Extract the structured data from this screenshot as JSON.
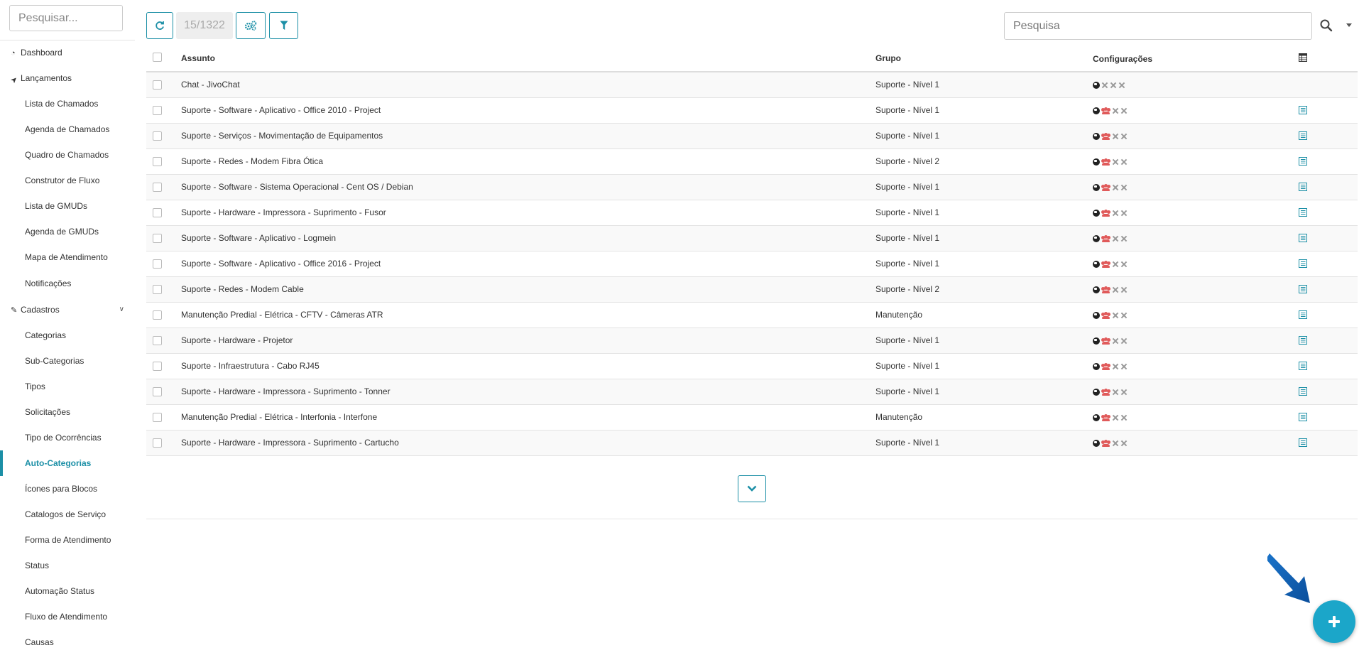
{
  "sidebar": {
    "search_placeholder": "Pesquisar...",
    "items": [
      {
        "label": "Dashboard",
        "icon": "dashboard-icon",
        "level": "top"
      },
      {
        "label": "Lançamentos",
        "icon": "location-arrow-icon",
        "level": "top"
      },
      {
        "label": "Lista de Chamados",
        "level": "sub"
      },
      {
        "label": "Agenda de Chamados",
        "level": "sub"
      },
      {
        "label": "Quadro de Chamados",
        "level": "sub"
      },
      {
        "label": "Construtor de Fluxo",
        "level": "sub"
      },
      {
        "label": "Lista de GMUDs",
        "level": "sub"
      },
      {
        "label": "Agenda de GMUDs",
        "level": "sub"
      },
      {
        "label": "Mapa de Atendimento",
        "level": "sub"
      },
      {
        "label": "Notificações",
        "level": "sub"
      },
      {
        "label": "Cadastros",
        "icon": "edit-icon",
        "level": "top",
        "expanded": true
      },
      {
        "label": "Categorias",
        "level": "sub"
      },
      {
        "label": "Sub-Categorias",
        "level": "sub"
      },
      {
        "label": "Tipos",
        "level": "sub"
      },
      {
        "label": "Solicitações",
        "level": "sub"
      },
      {
        "label": "Tipo de Ocorrências",
        "level": "sub"
      },
      {
        "label": "Auto-Categorias",
        "level": "sub",
        "active": true
      },
      {
        "label": "Ícones para Blocos",
        "level": "sub"
      },
      {
        "label": "Catalogos de Serviço",
        "level": "sub"
      },
      {
        "label": "Forma de Atendimento",
        "level": "sub"
      },
      {
        "label": "Status",
        "level": "sub"
      },
      {
        "label": "Automação Status",
        "level": "sub"
      },
      {
        "label": "Fluxo de Atendimento",
        "level": "sub"
      },
      {
        "label": "Causas",
        "level": "sub"
      }
    ]
  },
  "toolbar": {
    "record_count": "15/1322",
    "search_placeholder": "Pesquisa",
    "buttons": [
      "refresh-icon",
      "settings-icon",
      "filter-icon"
    ]
  },
  "table": {
    "headers": {
      "assunto": "Assunto",
      "grupo": "Grupo",
      "config": "Configurações"
    },
    "rows": [
      {
        "assunto": "Chat - JivoChat",
        "grupo": "Suporte - Nível 1",
        "users": false,
        "action": false
      },
      {
        "assunto": "Suporte - Software - Aplicativo - Office 2010 - Project",
        "grupo": "Suporte - Nível 1",
        "users": true,
        "action": true
      },
      {
        "assunto": "Suporte - Serviços - Movimentação de Equipamentos",
        "grupo": "Suporte - Nível 1",
        "users": true,
        "action": true
      },
      {
        "assunto": "Suporte - Redes - Modem Fibra Ótica",
        "grupo": "Suporte - Nível 2",
        "users": true,
        "action": true
      },
      {
        "assunto": "Suporte - Software - Sistema Operacional - Cent OS / Debian",
        "grupo": "Suporte - Nível 1",
        "users": true,
        "action": true
      },
      {
        "assunto": "Suporte - Hardware - Impressora - Suprimento - Fusor",
        "grupo": "Suporte - Nível 1",
        "users": true,
        "action": true
      },
      {
        "assunto": "Suporte - Software - Aplicativo - Logmein",
        "grupo": "Suporte - Nível 1",
        "users": true,
        "action": true
      },
      {
        "assunto": "Suporte - Software - Aplicativo - Office 2016 - Project",
        "grupo": "Suporte - Nível 1",
        "users": true,
        "action": true
      },
      {
        "assunto": "Suporte - Redes - Modem Cable",
        "grupo": "Suporte - Nível 2",
        "users": true,
        "action": true
      },
      {
        "assunto": "Manutenção Predial - Elétrica - CFTV - Câmeras ATR",
        "grupo": "Manutenção",
        "users": true,
        "action": true
      },
      {
        "assunto": "Suporte - Hardware - Projetor",
        "grupo": "Suporte - Nível 1",
        "users": true,
        "action": true
      },
      {
        "assunto": "Suporte - Infraestrutura - Cabo RJ45",
        "grupo": "Suporte - Nível 1",
        "users": true,
        "action": true
      },
      {
        "assunto": "Suporte - Hardware - Impressora - Suprimento - Tonner",
        "grupo": "Suporte - Nível 1",
        "users": true,
        "action": true
      },
      {
        "assunto": "Manutenção Predial - Elétrica - Interfonia - Interfone",
        "grupo": "Manutenção",
        "users": true,
        "action": true
      },
      {
        "assunto": "Suporte - Hardware - Impressora - Suprimento - Cartucho",
        "grupo": "Suporte - Nível 1",
        "users": true,
        "action": true
      }
    ]
  },
  "colors": {
    "accent": "#1b8fa6",
    "fab": "#1ba6c9",
    "users_icon": "#e05a5a"
  }
}
